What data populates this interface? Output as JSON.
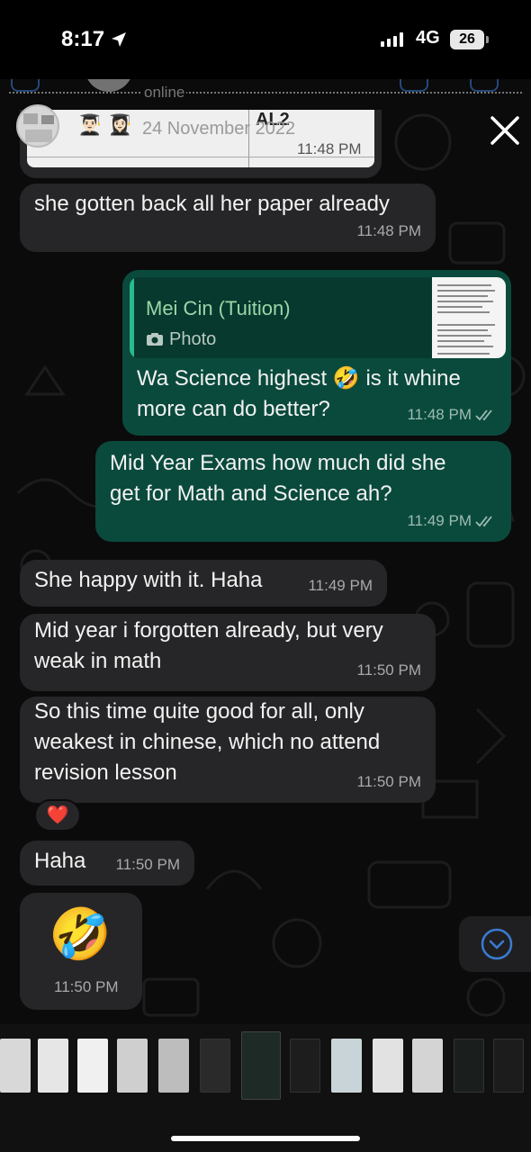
{
  "status_bar": {
    "time": "8:17",
    "network": "4G",
    "battery": "26"
  },
  "header": {
    "presence": "online"
  },
  "close_icon": "close-icon",
  "top_card": {
    "document_heading": "AL2",
    "date": "24 November 2022",
    "time": "11:48 PM"
  },
  "messages": [
    {
      "direction": "incoming",
      "text": "she gotten back all her paper already",
      "time": "11:48 PM"
    },
    {
      "direction": "outgoing",
      "reply_to": {
        "sender": "Mei Cin (Tuition)",
        "media_label": "Photo"
      },
      "text": "Wa Science highest 🤣 is it whine\nmore can do better?",
      "time": "11:48 PM"
    },
    {
      "direction": "outgoing",
      "text": "Mid Year Exams how much did she\nget for Math and Science ah?",
      "time": "11:49 PM"
    },
    {
      "direction": "incoming",
      "text": "She happy with it. Haha",
      "time": "11:49 PM"
    },
    {
      "direction": "incoming",
      "text": "Mid year i forgotten already, but very\nweak in math",
      "time": "11:50 PM"
    },
    {
      "direction": "incoming",
      "text": "So this time quite good for all, only\nweakest in chinese, which no attend\nrevision lesson",
      "time": "11:50 PM",
      "reaction": "❤️"
    },
    {
      "direction": "incoming",
      "text": "Haha",
      "time": "11:50 PM"
    },
    {
      "direction": "incoming",
      "text": "🤣",
      "time": "11:50 PM"
    }
  ],
  "thumbnail_strip": {
    "count": 13,
    "selected_index": 6
  },
  "colors": {
    "incoming_bubble": "#262628",
    "outgoing_bubble": "#0a4a3c",
    "quote_accent": "#2bb98f",
    "link_blue": "#3a7bd5"
  }
}
